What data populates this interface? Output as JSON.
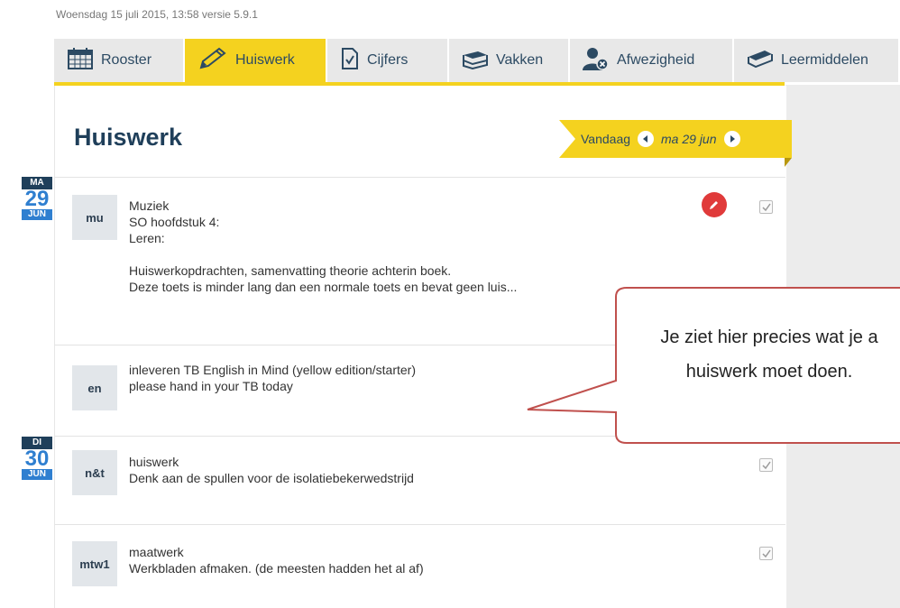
{
  "header": {
    "version_text": "Woensdag 15 juli 2015, 13:58 versie 5.9.1"
  },
  "tabs": [
    {
      "label": "Rooster",
      "icon": "calendar-icon",
      "active": false
    },
    {
      "label": "Huiswerk",
      "icon": "pencil-icon",
      "active": true
    },
    {
      "label": "Cijfers",
      "icon": "document-check-icon",
      "active": false
    },
    {
      "label": "Vakken",
      "icon": "books-icon",
      "active": false
    },
    {
      "label": "Afwezigheid",
      "icon": "person-x-icon",
      "active": false
    },
    {
      "label": "Leermiddelen",
      "icon": "book-icon",
      "active": false
    }
  ],
  "page": {
    "title": "Huiswerk",
    "today_label": "Vandaag",
    "current_date": "ma 29 jun"
  },
  "dates": [
    {
      "dow": "MA",
      "day": "29",
      "month": "JUN"
    },
    {
      "dow": "DI",
      "day": "30",
      "month": "JUN"
    }
  ],
  "homework": [
    {
      "subject_code": "mu",
      "lines": [
        "Muziek",
        "SO hoofdstuk 4:",
        "Leren:",
        "",
        "Huiswerkopdrachten, samenvatting theorie achterin boek.",
        "Deze toets is minder lang dan een normale toets en bevat geen luis..."
      ],
      "edited": true,
      "done": true
    },
    {
      "subject_code": "en",
      "lines": [
        "inleveren TB English in Mind (yellow edition/starter)",
        "please hand in your TB today"
      ],
      "edited": false,
      "done": false
    },
    {
      "subject_code": "n&t",
      "lines": [
        "huiswerk",
        "Denk aan de spullen voor de isolatiebekerwedstrijd"
      ],
      "edited": false,
      "done": true
    },
    {
      "subject_code": "mtw1",
      "lines": [
        "maatwerk",
        "Werkbladen afmaken. (de meesten hadden het al af)"
      ],
      "edited": false,
      "done": true
    }
  ],
  "callout": {
    "line1": "Je ziet hier precies wat je a",
    "line2": "huiswerk moet doen."
  },
  "colors": {
    "accent_yellow": "#f4d21f",
    "navy": "#1f3f5a",
    "blue": "#2f7fd0",
    "red": "#e03a3a",
    "callout_border": "#c0504d"
  }
}
